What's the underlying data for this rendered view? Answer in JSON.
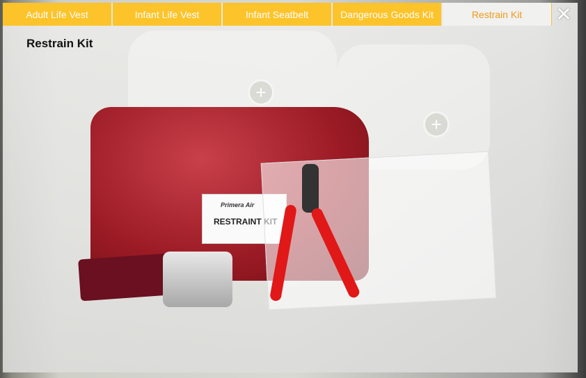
{
  "tabs": [
    {
      "label": "Adult Life Vest",
      "active": false
    },
    {
      "label": "Infant Life Vest",
      "active": false
    },
    {
      "label": "Infant Seatbelt",
      "active": false
    },
    {
      "label": "Dangerous Goods Kit",
      "active": false
    },
    {
      "label": "Restrain Kit",
      "active": true
    }
  ],
  "close_icon": "close-x-icon",
  "title": "Restrain Kit",
  "image": {
    "label_brand": "Primera Air",
    "label_text": "RESTRAINT KIT"
  },
  "hotspots": [
    "plus-icon",
    "plus-icon"
  ],
  "colors": {
    "tab": "#fdc32a",
    "active_tab_text": "#f09a1a"
  }
}
